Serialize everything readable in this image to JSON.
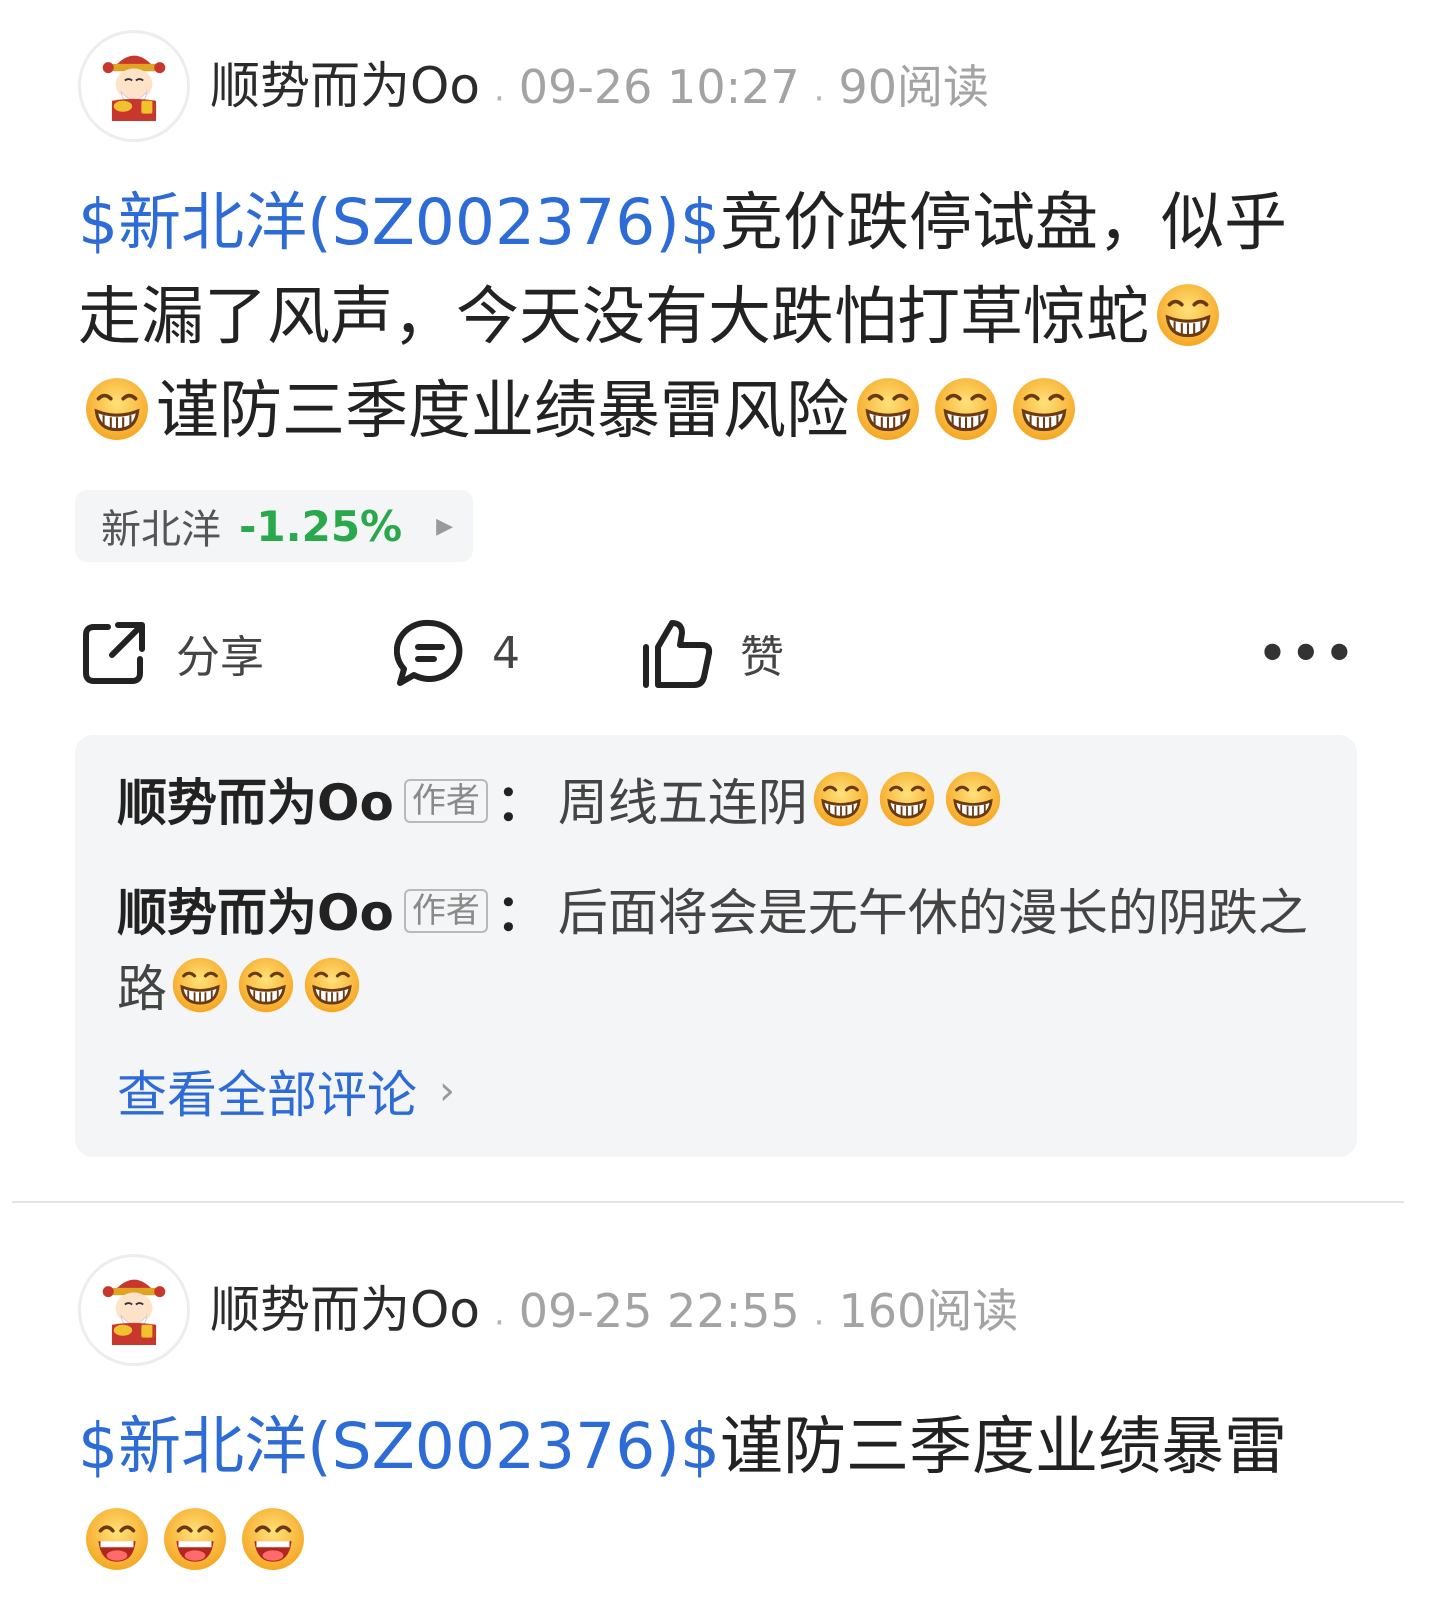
{
  "posts": [
    {
      "author": "顺势而为Oo",
      "time": "09-26 10:27",
      "reads": "90阅读",
      "stock_tag": "$新北洋(SZ002376)$",
      "text_line1": "竞价跌停试盘，似乎",
      "text_line2": "走漏了风声，今天没有大跌怕打草惊蛇",
      "text_line3": "谨防三季度业绩暴雷风险",
      "stock_chip": {
        "name": "新北洋",
        "change": "-1.25%"
      },
      "actions": {
        "share": "分享",
        "comments": "4",
        "like": "赞"
      },
      "comments": [
        {
          "author": "顺势而为Oo",
          "badge": "作者",
          "colon": "：",
          "text": "周线五连阴"
        },
        {
          "author": "顺势而为Oo",
          "badge": "作者",
          "colon": "：",
          "text": "后面将会是无午休的漫长的阴跌之路"
        }
      ],
      "view_all": "查看全部评论"
    },
    {
      "author": "顺势而为Oo",
      "time": "09-25 22:55",
      "reads": "160阅读",
      "stock_tag": "$新北洋(SZ002376)$",
      "text": "谨防三季度业绩暴雷"
    }
  ],
  "colors": {
    "link": "#2d6bd6",
    "down": "#2aa84c",
    "meta": "#a3a3a3"
  }
}
